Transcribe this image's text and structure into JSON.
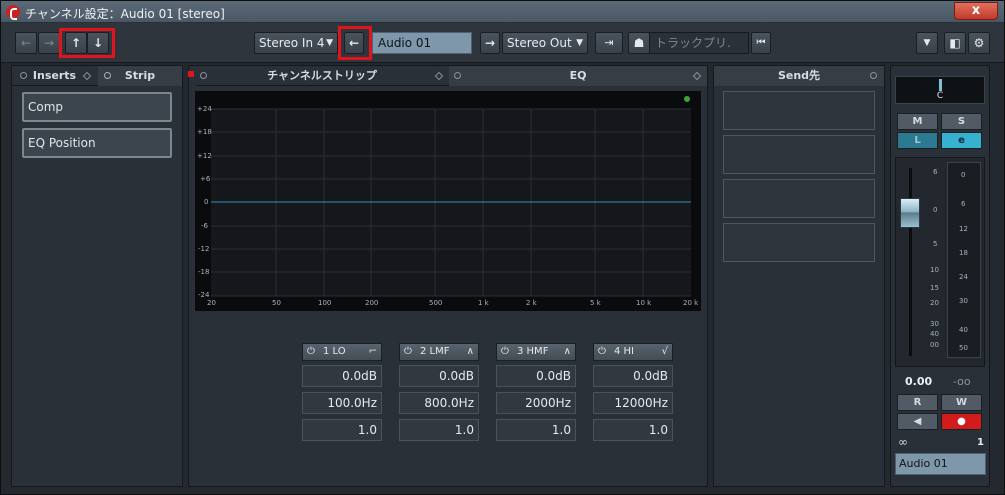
{
  "window": {
    "title": "チャンネル設定：Audio 01 [stereo]",
    "close_label": "x"
  },
  "toolbar": {
    "back_label": "←",
    "forward_label": "→",
    "up_label": "↑",
    "down_label": "↓",
    "input_routing": "Stereo In 4",
    "input_arrow": "←",
    "channel_name": "Audio 01",
    "output_arrow": "→",
    "output_routing": "Stereo Out",
    "search_placeholder": "トラックプリ.",
    "rewind_label": "⏮"
  },
  "left_panel": {
    "tabs": [
      "Inserts",
      "Strip"
    ],
    "slots": [
      "Comp",
      "EQ Position"
    ]
  },
  "eq_panel": {
    "tabs": [
      "チャンネルストリップ",
      "EQ"
    ],
    "y_labels": [
      "+24",
      "+18",
      "+12",
      "+6",
      "0",
      "-6",
      "-12",
      "-18",
      "-24"
    ],
    "x_labels": [
      "20",
      "50",
      "100",
      "200",
      "500",
      "1 k",
      "2 k",
      "5 k",
      "10 k",
      "20 k"
    ],
    "bands": [
      {
        "name": "1 LO",
        "gain": "0.0dB",
        "freq": "100.0Hz",
        "q": "1.0"
      },
      {
        "name": "2 LMF",
        "gain": "0.0dB",
        "freq": "800.0Hz",
        "q": "1.0"
      },
      {
        "name": "3 HMF",
        "gain": "0.0dB",
        "freq": "2000Hz",
        "q": "1.0"
      },
      {
        "name": "4 HI",
        "gain": "0.0dB",
        "freq": "12000Hz",
        "q": "1.0"
      }
    ]
  },
  "send_panel": {
    "title": "Send先"
  },
  "channel_strip": {
    "pan": "C",
    "buttons": {
      "mute": "M",
      "solo": "S",
      "listen": "L",
      "edit": "e",
      "read": "R",
      "write": "W"
    },
    "fader_scale": [
      "6",
      "0",
      "5",
      "10",
      "15",
      "20",
      "30",
      "40",
      "00"
    ],
    "meter_scale": [
      "0",
      "6",
      "12",
      "18",
      "24",
      "30",
      "40",
      "50"
    ],
    "volume": "0.00",
    "peak": "-oo",
    "channel_number": "1",
    "channel_name": "Audio 01"
  },
  "colors": {
    "accent": "#2fa7c6",
    "record": "#d21b1b",
    "highlight": "#e0141b",
    "name_field": "#7f97ab"
  }
}
